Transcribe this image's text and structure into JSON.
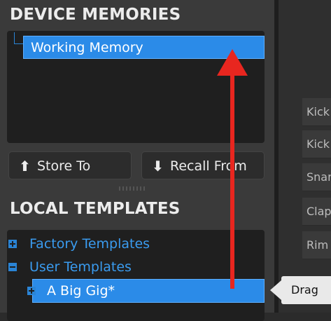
{
  "device_memories": {
    "title": "DEVICE MEMORIES",
    "selected_item": "Working Memory"
  },
  "buttons": {
    "store_to": "Store To",
    "recall_from": "Recall From"
  },
  "local_templates": {
    "title": "LOCAL TEMPLATES",
    "items": [
      {
        "label": "Factory Templates",
        "icon": "plus-icon"
      },
      {
        "label": "User Templates",
        "icon": "minus-icon"
      }
    ],
    "selected_item": "A Big Gig*"
  },
  "right_list": {
    "rows": [
      "Kick",
      "Kick",
      "Snare",
      "Clap",
      "Rim"
    ]
  },
  "tooltip": {
    "text": "Drag"
  },
  "colors": {
    "selection": "#2b8be8",
    "tree_blue": "#3a9bef",
    "arrow_red": "#e8261f"
  }
}
